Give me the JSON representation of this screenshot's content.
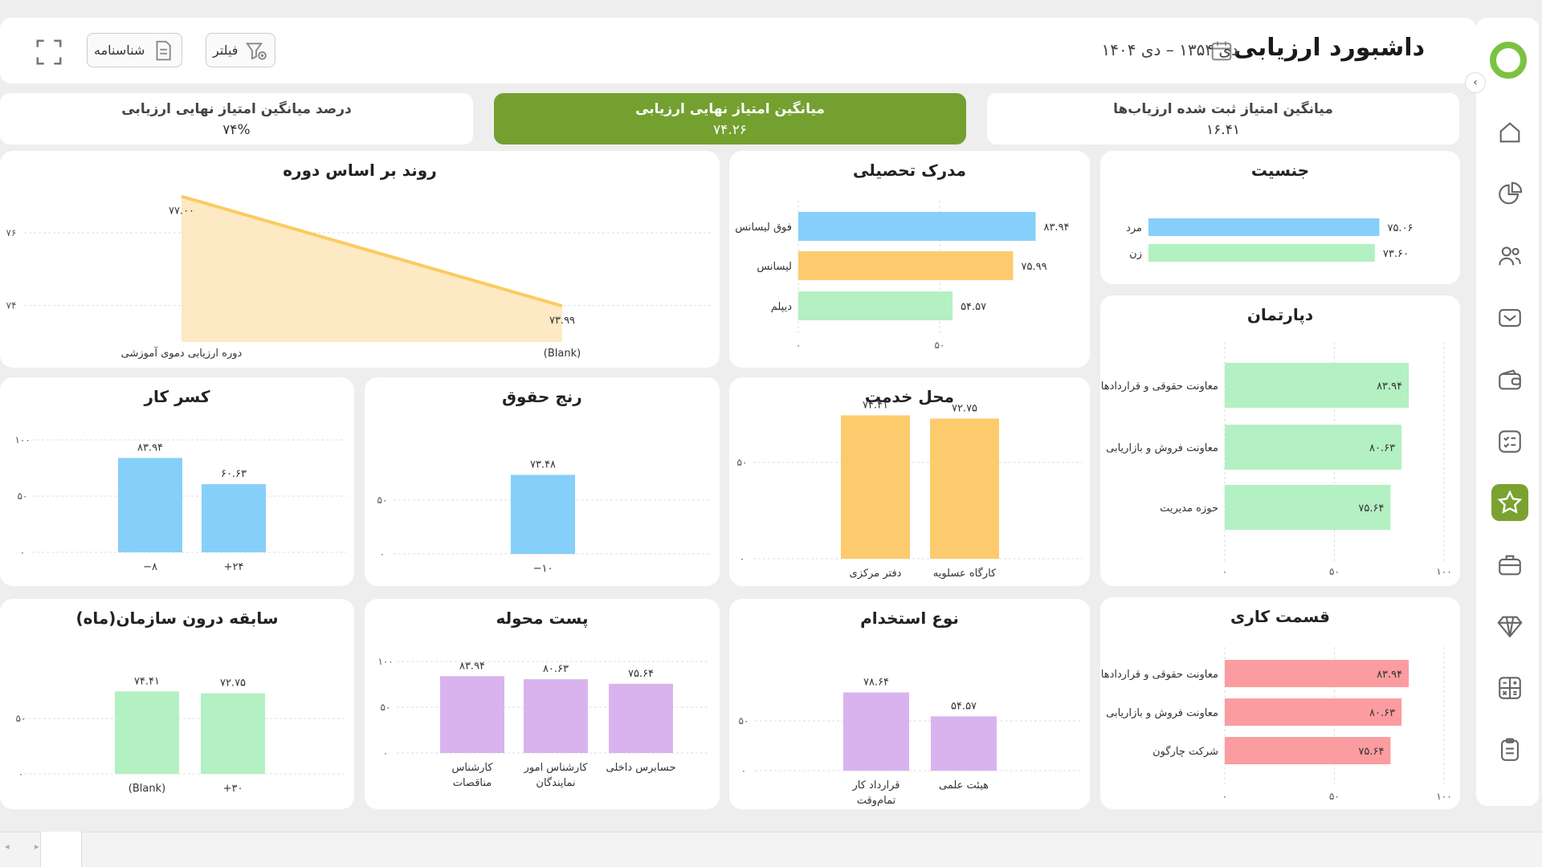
{
  "header": {
    "title": "داشبورد ارزیابی",
    "date_range": "دی ۱۳۵۴ – دی ۱۴۰۴",
    "filter_label": "فیلتر",
    "id_label": "شناسنامه"
  },
  "kpis": [
    {
      "label": "میانگین امتیاز ثبت شده ارزیاب‌ها",
      "value": "۱۶.۴۱"
    },
    {
      "label": "میانگین امتیاز نهایی ارزیابی",
      "value": "۷۴.۲۶"
    },
    {
      "label": "درصد میانگین امتیاز نهایی ارزیابی",
      "value": "۷۴%"
    }
  ],
  "sidebar": {
    "collapse_glyph": "‹",
    "items": [
      {
        "icon": "home-icon"
      },
      {
        "icon": "pie-chart-icon"
      },
      {
        "icon": "users-icon"
      },
      {
        "icon": "inbox-icon"
      },
      {
        "icon": "wallet-icon"
      },
      {
        "icon": "checklist-icon"
      },
      {
        "icon": "star-icon",
        "active": true
      },
      {
        "icon": "briefcase-icon"
      },
      {
        "icon": "diamond-icon"
      },
      {
        "icon": "calculator-icon"
      },
      {
        "icon": "clipboard-icon"
      }
    ]
  },
  "colors": {
    "blue": "#86cffb",
    "orange": "#fdcb6e",
    "green": "#b3f0c2",
    "purple": "#d9b3ee",
    "red": "#fb9ca0",
    "line": "#fbcb5e",
    "area": "#fde9c4",
    "accent": "#74a030"
  },
  "chart_data": [
    {
      "id": "gender",
      "type": "bar",
      "orientation": "horizontal",
      "title": "جنسیت",
      "categories": [
        "مرد",
        "زن"
      ],
      "values": [
        75.06,
        73.6
      ],
      "value_labels": [
        "۷۵.۰۶",
        "۷۳.۶۰"
      ],
      "xlim": [
        0,
        100
      ],
      "color": "#86cffb",
      "colors": [
        "#86cffb",
        "#b3f0c2"
      ]
    },
    {
      "id": "education",
      "type": "bar",
      "orientation": "horizontal",
      "title": "مدرک تحصیلی",
      "categories": [
        "فوق لیسانس",
        "لیسانس",
        "دیپلم"
      ],
      "values": [
        83.94,
        75.99,
        54.57
      ],
      "value_labels": [
        "۸۳.۹۴",
        "۷۵.۹۹",
        "۵۴.۵۷"
      ],
      "xlim": [
        0,
        100
      ],
      "x_ticks": [
        0,
        50
      ],
      "x_tick_labels": [
        "۰",
        "۵۰"
      ],
      "colors": [
        "#86cffb",
        "#fdcb6e",
        "#b3f0c2"
      ]
    },
    {
      "id": "trend",
      "type": "area",
      "title": "روند بر اساس دوره",
      "categories": [
        "دوره ارزیابی دموی آموزشی",
        "(Blank)"
      ],
      "values": [
        77.0,
        73.99
      ],
      "value_labels": [
        "۷۷.۰۰",
        "۷۳.۹۹"
      ],
      "ylim": [
        73.0,
        77.5
      ],
      "y_ticks": [
        74,
        76
      ],
      "y_tick_labels": [
        "۷۴",
        "۷۶"
      ]
    },
    {
      "id": "department",
      "type": "bar",
      "orientation": "horizontal",
      "title": "دپارتمان",
      "categories": [
        "معاونت حقوقی و قراردادها",
        "معاونت فروش و بازاریابی",
        "حوزه مدیریت"
      ],
      "values": [
        83.94,
        80.63,
        75.64
      ],
      "value_labels": [
        "۸۳.۹۴",
        "۸۰.۶۳",
        "۷۵.۶۴"
      ],
      "xlim": [
        0,
        100
      ],
      "x_ticks": [
        0,
        50,
        100
      ],
      "x_tick_labels": [
        "۰",
        "۵۰",
        "۱۰۰"
      ],
      "color": "#b3f0c2"
    },
    {
      "id": "service_location",
      "type": "bar",
      "title": "محل خدمت",
      "categories": [
        "دفتر مرکزی",
        "کارگاه عسلویه"
      ],
      "values": [
        74.41,
        72.75
      ],
      "value_labels": [
        "۷۴.۴۱",
        "۷۲.۷۵"
      ],
      "ylim": [
        0,
        100
      ],
      "y_ticks": [
        0,
        50
      ],
      "y_tick_labels": [
        "۰",
        "۵۰"
      ],
      "color": "#fdcb6e"
    },
    {
      "id": "salary_range",
      "type": "bar",
      "title": "رنج حقوق",
      "categories": [
        "−۱۰"
      ],
      "values": [
        73.48
      ],
      "value_labels": [
        "۷۳.۴۸"
      ],
      "ylim": [
        0,
        100
      ],
      "y_ticks": [
        0,
        50
      ],
      "y_tick_labels": [
        "۰",
        "۵۰"
      ],
      "color": "#86cffb"
    },
    {
      "id": "work_deficit",
      "type": "bar",
      "title": "کسر کار",
      "categories": [
        "−۸",
        "+۲۴"
      ],
      "values": [
        83.94,
        60.63
      ],
      "value_labels": [
        "۸۳.۹۴",
        "۶۰.۶۳"
      ],
      "ylim": [
        0,
        100
      ],
      "y_ticks": [
        0,
        50,
        100
      ],
      "y_tick_labels": [
        "۰",
        "۵۰",
        "۱۰۰"
      ],
      "color": "#86cffb"
    },
    {
      "id": "work_section",
      "type": "bar",
      "orientation": "horizontal",
      "title": "قسمت کاری",
      "categories": [
        "معاونت حقوقی و قراردادها",
        "معاونت فروش و بازاریابی",
        "شرکت چارگون"
      ],
      "values": [
        83.94,
        80.63,
        75.64
      ],
      "value_labels": [
        "۸۳.۹۴",
        "۸۰.۶۳",
        "۷۵.۶۴"
      ],
      "xlim": [
        0,
        100
      ],
      "x_ticks": [
        0,
        50,
        100
      ],
      "x_tick_labels": [
        "۰",
        "۵۰",
        "۱۰۰"
      ],
      "color": "#fb9ca0"
    },
    {
      "id": "employment_type",
      "type": "bar",
      "title": "نوع استخدام",
      "categories": [
        "قرارداد کار تمام‌وقت",
        "هیئت علمی"
      ],
      "category_lines": [
        [
          "قرارداد کار",
          "تمام‌وقت"
        ],
        [
          "هیئت علمی"
        ]
      ],
      "values": [
        78.64,
        54.57
      ],
      "value_labels": [
        "۷۸.۶۴",
        "۵۴.۵۷"
      ],
      "ylim": [
        0,
        100
      ],
      "y_ticks": [
        0,
        50
      ],
      "y_tick_labels": [
        "۰",
        "۵۰"
      ],
      "color": "#d9b3ee"
    },
    {
      "id": "assigned_post",
      "type": "bar",
      "title": "پست محوله",
      "categories": [
        "کارشناس مناقصات",
        "کارشناس امور نمایندگان",
        "حسابرس داخلی"
      ],
      "category_lines": [
        [
          "کارشناس",
          "مناقصات"
        ],
        [
          "کارشناس امور",
          "نمایندگان"
        ],
        [
          "حسابرس داخلی"
        ]
      ],
      "values": [
        83.94,
        80.63,
        75.64
      ],
      "value_labels": [
        "۸۳.۹۴",
        "۸۰.۶۳",
        "۷۵.۶۴"
      ],
      "ylim": [
        0,
        100
      ],
      "y_ticks": [
        0,
        50,
        100
      ],
      "y_tick_labels": [
        "۰",
        "۵۰",
        "۱۰۰"
      ],
      "color": "#d9b3ee"
    },
    {
      "id": "tenure",
      "type": "bar",
      "title": "سابقه درون سازمان(ماه)",
      "categories": [
        "(Blank)",
        "+۳۰"
      ],
      "values": [
        74.41,
        72.75
      ],
      "value_labels": [
        "۷۴.۴۱",
        "۷۲.۷۵"
      ],
      "ylim": [
        0,
        100
      ],
      "y_ticks": [
        0,
        50
      ],
      "y_tick_labels": [
        "۰",
        "۵۰"
      ],
      "color": "#b3f0c2"
    }
  ]
}
